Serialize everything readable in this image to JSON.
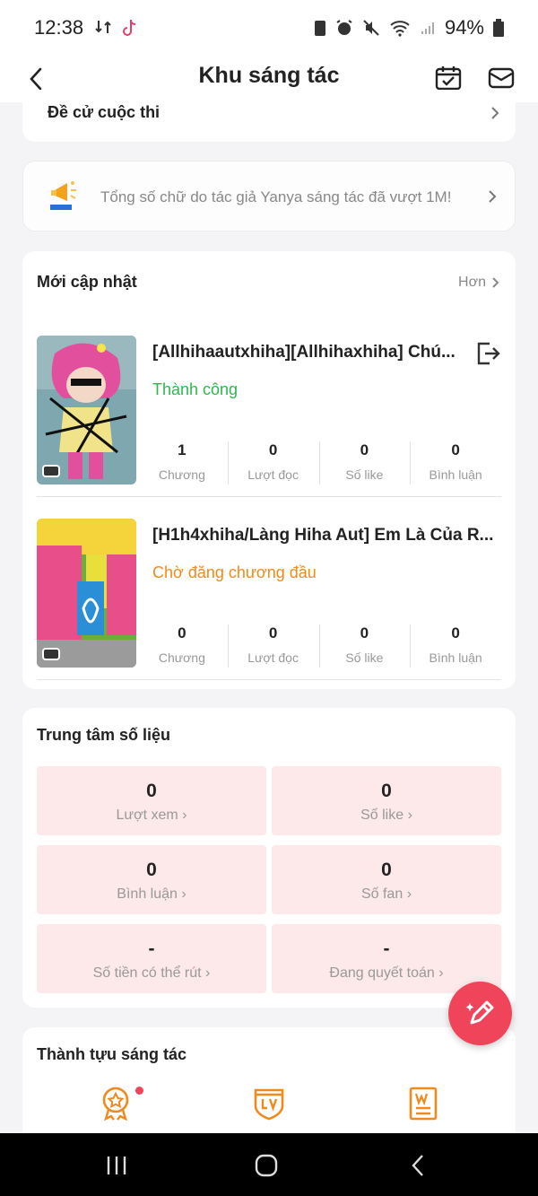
{
  "status_bar": {
    "time": "12:38",
    "battery": "94%"
  },
  "header": {
    "title": "Khu sáng tác"
  },
  "nominate": {
    "label": "Đề cử cuộc thi"
  },
  "notice": {
    "text": "Tổng số chữ do tác giả Yanya sáng tác đã vượt 1M!"
  },
  "updates": {
    "title": "Mới cập nhật",
    "more": "Hơn",
    "stories": [
      {
        "title": "[Allhihaautxhiha][Allhihaxhiha] Chú...",
        "status": "Thành công",
        "status_color": "#2bb84b",
        "stats": [
          {
            "value": "1",
            "label": "Chương"
          },
          {
            "value": "0",
            "label": "Lượt đọc"
          },
          {
            "value": "0",
            "label": "Số like"
          },
          {
            "value": "0",
            "label": "Bình luận"
          }
        ]
      },
      {
        "title": "[H1h4xhiha/Làng Hiha Aut] Em Là Của R...",
        "status": "Chờ đăng chương đầu",
        "status_color": "#f08a1c",
        "stats": [
          {
            "value": "0",
            "label": "Chương"
          },
          {
            "value": "0",
            "label": "Lượt đọc"
          },
          {
            "value": "0",
            "label": "Số like"
          },
          {
            "value": "0",
            "label": "Bình luận"
          }
        ]
      }
    ]
  },
  "data_center": {
    "title": "Trung tâm số liệu",
    "items": [
      {
        "value": "0",
        "label": "Lượt xem"
      },
      {
        "value": "0",
        "label": "Số like"
      },
      {
        "value": "0",
        "label": "Bình luận"
      },
      {
        "value": "0",
        "label": "Số fan"
      },
      {
        "value": "-",
        "label": "Số tiền có thể rút"
      },
      {
        "value": "-",
        "label": "Đang quyết toán"
      }
    ]
  },
  "achievements": {
    "title": "Thành tựu sáng tác",
    "icons": [
      "medal-icon",
      "level-badge-icon",
      "writing-certificate-icon"
    ]
  },
  "colors": {
    "accent": "#f0445a",
    "data_box": "#fde8ea",
    "achievement_icon": "#f08a1c"
  }
}
